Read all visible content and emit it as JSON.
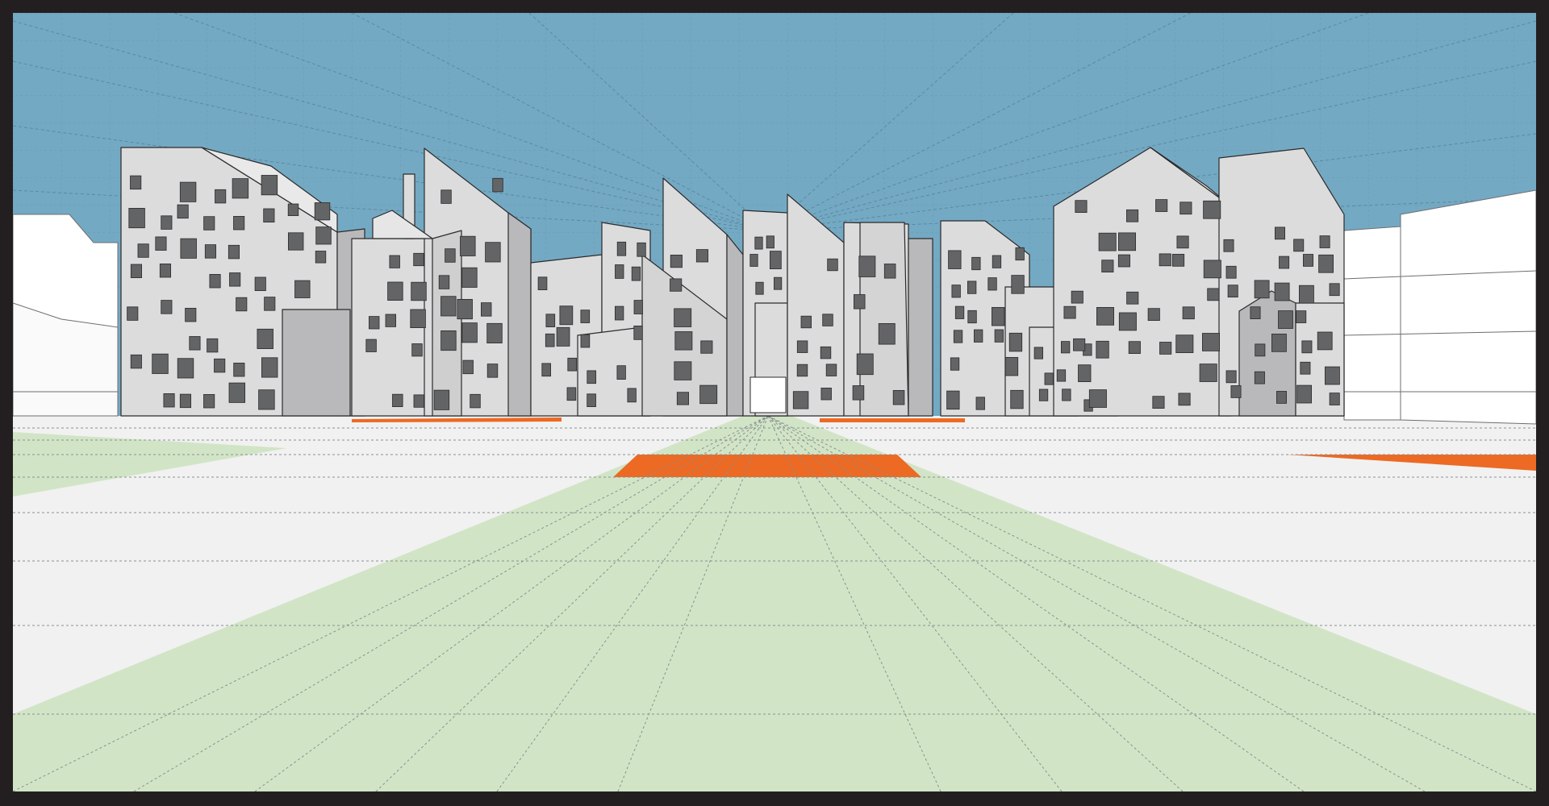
{
  "scene": {
    "kind": "architectural perspective rendering",
    "colors": {
      "frame": "#231f20",
      "sky": "#74a9c3",
      "ground": "#f1f1f1",
      "lawn": "#d1e5c6",
      "paving_accent": "#ec6a23",
      "facade": "#dcdcdd",
      "facade_shadow": "#b9b9bb",
      "window": "#636466",
      "outline": "#2b2b2b",
      "context_building": "#ffffff",
      "construction_line": "#8a8f93"
    },
    "labels": []
  }
}
